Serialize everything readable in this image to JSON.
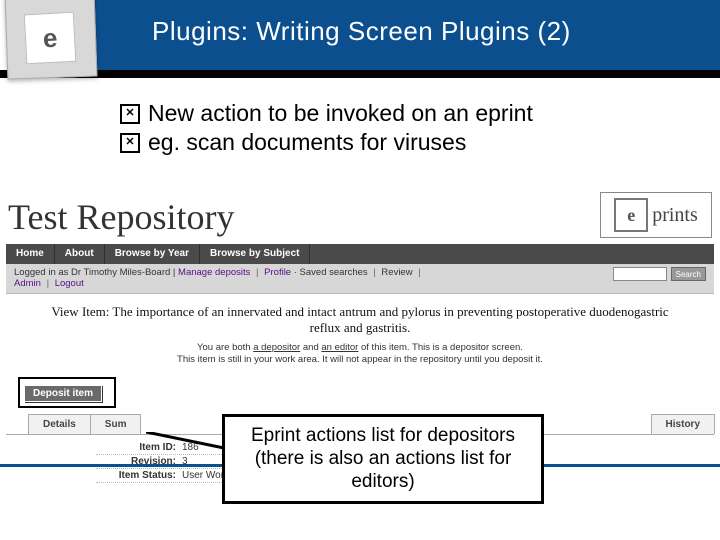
{
  "slide": {
    "title": "Plugins: Writing Screen Plugins (2)",
    "logo_letter": "e",
    "bullets": [
      "New action to be invoked on an eprint",
      "eg. scan documents for viruses"
    ]
  },
  "repo": {
    "title": "Test Repository",
    "brand_glyph": "e",
    "brand_word": "prints",
    "nav": [
      "Home",
      "About",
      "Browse by Year",
      "Browse by Subject"
    ],
    "status_prefix": "Logged in as Dr Timothy Miles-Board |",
    "links": {
      "manage": "Manage deposits",
      "profile": "Profile",
      "saved": "Saved searches",
      "review": "Review",
      "admin": "Admin",
      "logout": "Logout"
    },
    "search_label": "Search",
    "view_item": "View Item: The importance of an innervated and intact antrum and pylorus in preventing postoperative duodenogastric reflux and gastritis.",
    "notice_line1_pre": "You are both",
    "notice_dep": "a depositor",
    "notice_mid": "and",
    "notice_ed": "an editor",
    "notice_line1_post": "of this item. This is a depositor screen.",
    "notice_line2": "This item is still in your work area. It will not appear in the repository until you deposit it.",
    "deposit_label": "Deposit item",
    "tabs": [
      "Details",
      "Sum",
      "",
      "",
      "History"
    ],
    "details": {
      "item_id_k": "Item ID:",
      "item_id_v": "186",
      "revision_k": "Revision:",
      "revision_v": "3",
      "status_k": "Item Status:",
      "status_v": "User Workarea"
    }
  },
  "callout": "Eprint actions list for depositors (there is also an actions list for editors)"
}
